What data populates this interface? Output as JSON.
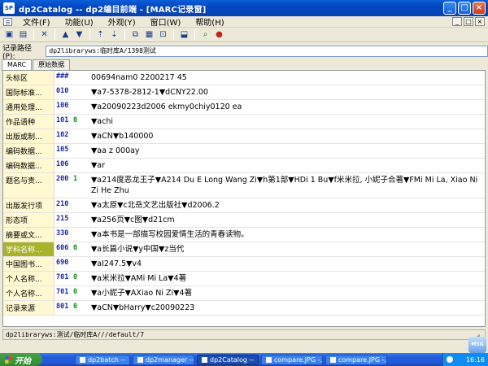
{
  "window": {
    "title": "dp2Catalog -- dp2编目前端 - [MARC记录窗]",
    "app_icon": "SP",
    "controls": [
      "_",
      "□",
      "×"
    ]
  },
  "menubar": {
    "items": [
      "文件(F)",
      "功能(U)",
      "外观(Y)",
      "窗口(W)",
      "帮助(H)"
    ],
    "mdi_controls": [
      "_",
      "□",
      "×"
    ]
  },
  "toolbar": {
    "buttons": [
      {
        "name": "save-icon",
        "glyph": "▣"
      },
      {
        "name": "save-to-icon",
        "glyph": "▤"
      },
      {
        "name": "delete-icon",
        "glyph": "✕"
      },
      {
        "name": "prev-icon",
        "glyph": "▲"
      },
      {
        "name": "next-icon",
        "glyph": "▼"
      },
      {
        "name": "first-icon",
        "glyph": "⇡"
      },
      {
        "name": "last-icon",
        "glyph": "⇣"
      },
      {
        "name": "copy-icon",
        "glyph": "⧉"
      },
      {
        "name": "template-icon",
        "glyph": "▦"
      },
      {
        "name": "load-icon",
        "glyph": "⊡"
      },
      {
        "name": "export-icon",
        "glyph": "⬓"
      },
      {
        "name": "search-icon",
        "glyph": "⌕"
      },
      {
        "name": "stop-icon",
        "glyph": "●"
      }
    ]
  },
  "path": {
    "label": "记录路径(P):",
    "value": "dp2libraryws:临时库A/1398测试"
  },
  "tabs": [
    {
      "label": "MARC",
      "active": true
    },
    {
      "label": "原始数据",
      "active": false
    }
  ],
  "marc": {
    "rows": [
      {
        "name": "头标区",
        "tag": "###",
        "ind": "",
        "value": "00694nam0 2200217   45"
      },
      {
        "name": "国际标准...",
        "tag": "010",
        "ind": "",
        "value": "▼a7-5378-2812-1▼dCNY22.00"
      },
      {
        "name": "通用处理...",
        "tag": "100",
        "ind": "",
        "value": "▼a20090223d2006    ekmy0chiy0120    ea"
      },
      {
        "name": "作品语种",
        "tag": "101",
        "ind": "0",
        "value": "▼achi"
      },
      {
        "name": "出版或制...",
        "tag": "102",
        "ind": "",
        "value": "▼aCN▼b140000"
      },
      {
        "name": "编码数据...",
        "tag": "105",
        "ind": "",
        "value": "▼aa   z   000ay"
      },
      {
        "name": "编码数据...",
        "tag": "106",
        "ind": "",
        "value": "▼ar"
      },
      {
        "name": "题名与责...",
        "tag": "200",
        "ind": "1",
        "value": "▼a214度恶龙王子▼A214 Du E Long Wang Zi▼h第1部▼HDi 1 Bu▼f米米拉, 小妮子合著▼FMi Mi La,   Xiao Ni Zi He Zhu"
      },
      {
        "name": "出版发行项",
        "tag": "210",
        "ind": "",
        "value": "▼a太原▼c北岳文艺出版社▼d2006.2"
      },
      {
        "name": "形态项",
        "tag": "215",
        "ind": "",
        "value": "▼a256页▼c图▼d21cm"
      },
      {
        "name": "摘要或文...",
        "tag": "330",
        "ind": "",
        "value": "▼a本书是一部描写校园爱情生活的青春读物。"
      },
      {
        "name": "学科名称...",
        "tag": "606",
        "ind": "0",
        "value": "▼a长篇小说▼y中国▼z当代",
        "selected": true
      },
      {
        "name": "中国图书...",
        "tag": "690",
        "ind": "",
        "value": "▼aI247.5▼v4"
      },
      {
        "name": "个人名称...",
        "tag": "701",
        "ind": "0",
        "value": "▼a米米拉▼AMi Mi La▼4著"
      },
      {
        "name": "个人名称...",
        "tag": "701",
        "ind": "0",
        "value": "▼a小妮子▼AXiao Ni Zi▼4著"
      },
      {
        "name": "记录来源",
        "tag": "801",
        "ind": "0",
        "value": "▼aCN▼bHarry▼c20090223"
      }
    ]
  },
  "status": {
    "text": "dp2libraryws:测试/临时库A///default/7"
  },
  "taskbar": {
    "start_label": "开始",
    "tasks": [
      {
        "label": "dp2batch --",
        "active": false
      },
      {
        "label": "dp2manager --",
        "active": false
      },
      {
        "label": "dp2Catalog --",
        "active": true
      },
      {
        "label": "compare.JPG -...",
        "active": false
      },
      {
        "label": "compare.JPG -...",
        "active": false
      }
    ],
    "clock": "16:16"
  },
  "corner_badge": "MSG",
  "colors": {
    "title_blue": "#0445c0",
    "tag_blue": "#1a2aa8",
    "ind_green": "#1a8a1a",
    "name_bg": "#fff8d0",
    "selected_bg": "#a8b22a"
  }
}
